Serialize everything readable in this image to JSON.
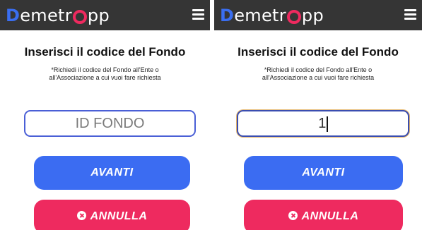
{
  "app": {
    "logo_first": "D",
    "logo_middle": "emetr",
    "logo_circle": "a",
    "logo_end": "pp"
  },
  "screens": [
    {
      "title": "Inserisci il codice del Fondo",
      "subtitle_line1": "*Richiedi il codice del Fondo all'Ente o",
      "subtitle_line2": "all'Associazione a cui vuoi fare richiesta",
      "input_placeholder": "ID FONDO",
      "input_value": "",
      "avanti_label": "AVANTI",
      "annulla_label": "ANNULLA"
    },
    {
      "title": "Inserisci il codice del Fondo",
      "subtitle_line1": "*Richiedi il codice del Fondo all'Ente o",
      "subtitle_line2": "all'Associazione a cui vuoi fare richiesta",
      "input_placeholder": "ID FONDO",
      "input_value": "1",
      "avanti_label": "AVANTI",
      "annulla_label": "ANNULLA"
    }
  ],
  "icons": {
    "menu": "hamburger-menu-icon",
    "cancel": "close-circle-icon"
  },
  "colors": {
    "topbar": "#353535",
    "brand_blue": "#3b6cf2",
    "brand_pink": "#ee2a5f"
  }
}
